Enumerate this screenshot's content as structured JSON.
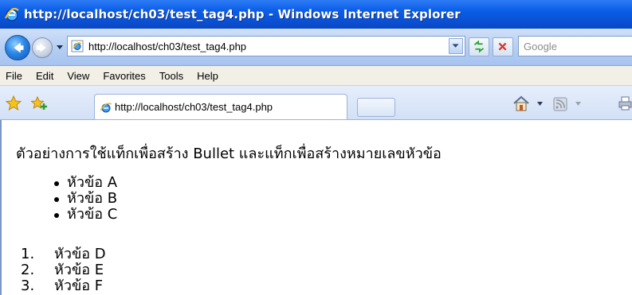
{
  "window": {
    "title": "http://localhost/ch03/test_tag4.php - Windows Internet Explorer"
  },
  "address_bar": {
    "url": "http://localhost/ch03/test_tag4.php"
  },
  "search": {
    "placeholder": "Google"
  },
  "menu": {
    "items": [
      "File",
      "Edit",
      "View",
      "Favorites",
      "Tools",
      "Help"
    ]
  },
  "tab": {
    "label": "http://localhost/ch03/test_tag4.php"
  },
  "content": {
    "heading": "ตัวอย่างการใช้แท็กเพื่อสร้าง Bullet และแท็กเพื่อสร้างหมายเลขหัวข้อ",
    "bullet_items": [
      "หัวข้อ A",
      "หัวข้อ B",
      "หัวข้อ C"
    ],
    "numbered_items": [
      {
        "num": "1.",
        "text": "หัวข้อ D"
      },
      {
        "num": "2.",
        "text": "หัวข้อ E"
      },
      {
        "num": "3.",
        "text": "หัวข้อ F"
      }
    ]
  },
  "colors": {
    "titlebar": "#0c5fe8",
    "menubar": "#f1efe6",
    "toolbar": "#d3e0f6"
  }
}
